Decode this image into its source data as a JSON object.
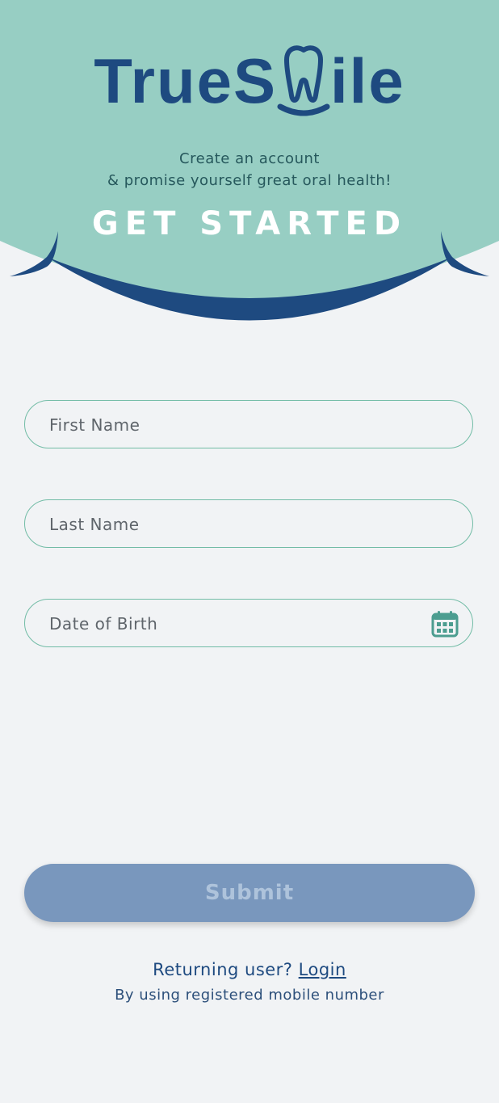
{
  "brand": {
    "prefix": "TrueS",
    "suffix": "ile",
    "logo_mark": "tooth-smile-icon"
  },
  "header": {
    "subtitle_line1": "Create an account",
    "subtitle_line2": "& promise yourself great oral health!",
    "heading": "GET STARTED"
  },
  "form": {
    "first_name_placeholder": "First Name",
    "last_name_placeholder": "Last Name",
    "dob_placeholder": "Date of Birth",
    "dob_icon": "calendar-icon",
    "submit_label": "Submit"
  },
  "footer": {
    "returning_text": "Returning user?",
    "login_label": "Login",
    "note": "By using registered mobile number"
  },
  "colors": {
    "header_bg": "#97cec3",
    "brand_blue": "#1e4a80",
    "field_border": "#72bca6",
    "submit_bg": "#7997bd",
    "page_bg": "#f1f3f5"
  }
}
